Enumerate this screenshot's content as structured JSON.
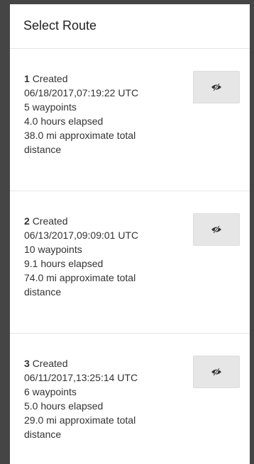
{
  "panel": {
    "title": "Select Route"
  },
  "routes": [
    {
      "number": "1",
      "created_label": "Created",
      "timestamp": "06/18/2017,07:19:22 UTC",
      "waypoints": "5 waypoints",
      "elapsed": "4.0 hours elapsed",
      "distance": "38.0 mi approximate total distance",
      "icon": "eye-slash-icon"
    },
    {
      "number": "2",
      "created_label": "Created",
      "timestamp": "06/13/2017,09:09:01 UTC",
      "waypoints": "10 waypoints",
      "elapsed": "9.1 hours elapsed",
      "distance": "74.0 mi approximate total distance",
      "icon": "eye-slash-icon"
    },
    {
      "number": "3",
      "created_label": "Created",
      "timestamp": "06/11/2017,13:25:14 UTC",
      "waypoints": "6 waypoints",
      "elapsed": "5.0 hours elapsed",
      "distance": "29.0 mi approximate total distance",
      "icon": "eye-slash-icon"
    }
  ]
}
